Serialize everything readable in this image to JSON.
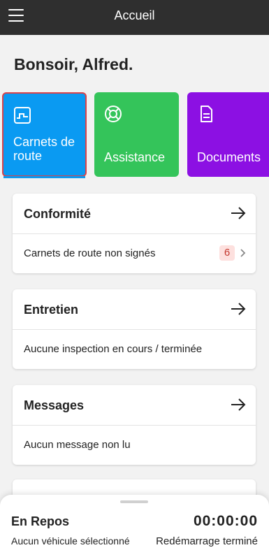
{
  "header": {
    "title": "Accueil",
    "menu_icon": "hamburger-menu-icon"
  },
  "greeting": "Bonsoir, Alfred.",
  "tiles": [
    {
      "label": "Carnets de route",
      "icon": "logbook-chart-icon",
      "color": "#0a9af2"
    },
    {
      "label": "Assistance",
      "icon": "lifebuoy-icon",
      "color": "#34c45a"
    },
    {
      "label": "Documents",
      "icon": "document-icon",
      "color": "#8c10e3"
    }
  ],
  "cards": [
    {
      "title": "Conformité",
      "row": "Carnets de route non signés",
      "badge": "6"
    },
    {
      "title": "Entretien",
      "row": "Aucune inspection en cours / terminée"
    },
    {
      "title": "Messages",
      "row": "Aucun message non lu"
    }
  ],
  "bottom": {
    "status": "En Repos",
    "timer": "00:00:00",
    "vehicle": "Aucun véhicule sélectionné",
    "restart": "Redémarrage terminé"
  },
  "colors": {
    "header_bg": "#2f2f2f",
    "badge_bg": "#fde0de",
    "badge_text": "#c43a30"
  }
}
